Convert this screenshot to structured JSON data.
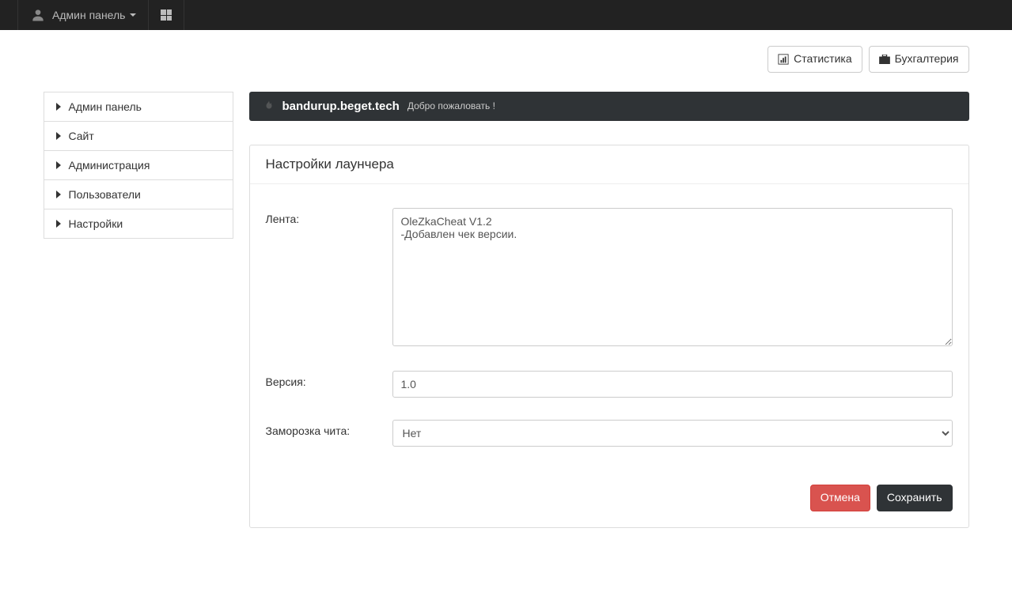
{
  "top_nav": {
    "admin_label": "Админ панель"
  },
  "toolbar": {
    "stats_label": "Статистика",
    "accounting_label": "Бухгалтерия"
  },
  "sidebar": {
    "items": [
      {
        "label": "Админ панель"
      },
      {
        "label": "Сайт"
      },
      {
        "label": "Администрация"
      },
      {
        "label": "Пользователи"
      },
      {
        "label": "Настройки"
      }
    ]
  },
  "welcome": {
    "site_name": "bandurup.beget.tech",
    "greeting": "Добро пожаловать !"
  },
  "panel": {
    "title": "Настройки лаунчера"
  },
  "form": {
    "feed_label": "Лента:",
    "feed_value": "OleZkaCheat V1.2\n-Добавлен чек версии.",
    "version_label": "Версия:",
    "version_value": "1.0",
    "freeze_label": "Заморозка чита:",
    "freeze_value": "Нет"
  },
  "actions": {
    "cancel": "Отмена",
    "save": "Сохранить"
  }
}
